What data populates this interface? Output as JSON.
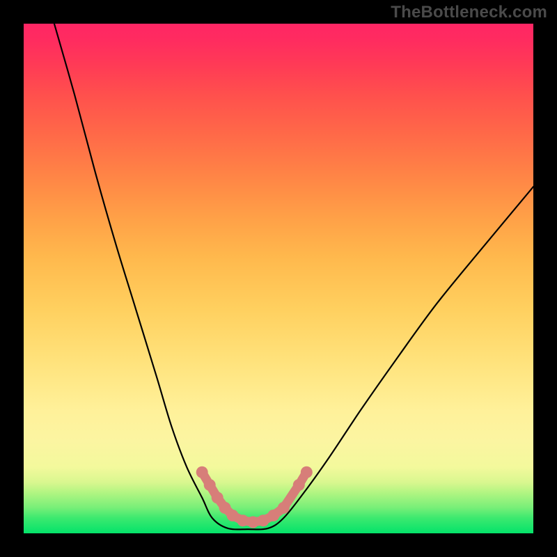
{
  "watermark": "TheBottleneck.com",
  "colors": {
    "frame": "#000000",
    "curve": "#000000",
    "marker": "#d77e79",
    "gradient_top": "#ff2664",
    "gradient_mid": "#ffe27b",
    "gradient_bottom": "#04e36a"
  },
  "chart_data": {
    "type": "line",
    "title": "",
    "xlabel": "",
    "ylabel": "",
    "xlim": [
      0,
      100
    ],
    "ylim": [
      0,
      100
    ],
    "series": [
      {
        "name": "bottleneck-curve-left",
        "x": [
          6,
          10,
          14,
          18,
          22,
          26,
          29,
          32,
          35,
          37
        ],
        "y": [
          100,
          86,
          71,
          57,
          44,
          31,
          21,
          13,
          7,
          3
        ]
      },
      {
        "name": "bottleneck-curve-valley",
        "x": [
          37,
          40,
          44,
          48,
          51
        ],
        "y": [
          3,
          1,
          0.8,
          1,
          3
        ]
      },
      {
        "name": "bottleneck-curve-right",
        "x": [
          51,
          55,
          60,
          66,
          73,
          81,
          90,
          100
        ],
        "y": [
          3,
          8,
          15,
          24,
          34,
          45,
          56,
          68
        ]
      }
    ],
    "markers": {
      "name": "highlight-dots",
      "points": [
        {
          "x": 35,
          "y": 12
        },
        {
          "x": 36.5,
          "y": 9.5
        },
        {
          "x": 38,
          "y": 7
        },
        {
          "x": 39.5,
          "y": 5
        },
        {
          "x": 41,
          "y": 3.5
        },
        {
          "x": 43,
          "y": 2.5
        },
        {
          "x": 45,
          "y": 2.2
        },
        {
          "x": 47,
          "y": 2.5
        },
        {
          "x": 49,
          "y": 3.5
        },
        {
          "x": 51,
          "y": 5
        },
        {
          "x": 54,
          "y": 9.5
        },
        {
          "x": 55.5,
          "y": 12
        }
      ]
    },
    "grid": false,
    "legend": false
  }
}
